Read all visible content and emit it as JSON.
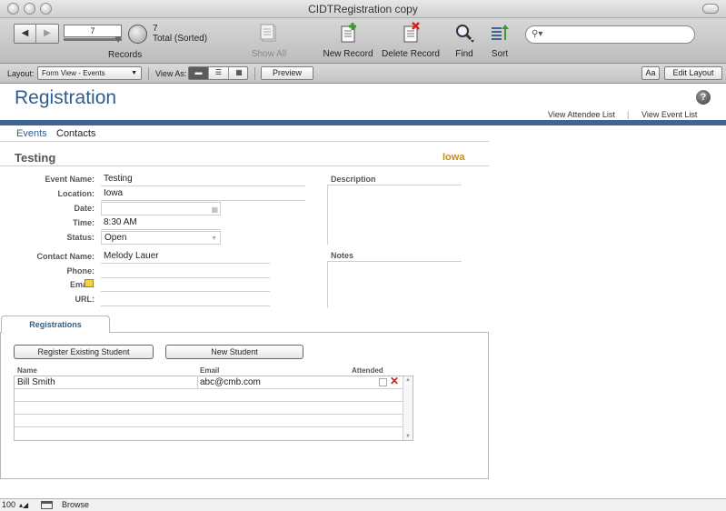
{
  "window": {
    "title": "CIDTRegistration copy"
  },
  "toolbar": {
    "record_number": "7",
    "record_total": "7",
    "record_total_label": "Total (Sorted)",
    "records_label": "Records",
    "show_all_label": "Show All",
    "new_record_label": "New Record",
    "delete_record_label": "Delete Record",
    "find_label": "Find",
    "sort_label": "Sort",
    "search_value": ""
  },
  "layout_bar": {
    "layout_label": "Layout:",
    "layout_value": "Form View - Events",
    "view_as_label": "View As:",
    "preview_label": "Preview",
    "font_button": "Aa",
    "edit_layout_label": "Edit Layout"
  },
  "header": {
    "title": "Registration",
    "help_glyph": "?",
    "view_attendee_list": "View Attendee List",
    "link_separator": "|",
    "view_event_list": "View Event List"
  },
  "tabs": {
    "events": "Events",
    "contacts": "Contacts"
  },
  "record": {
    "name": "Testing",
    "state": "Iowa",
    "fields": {
      "event_name_label": "Event Name:",
      "event_name": "Testing",
      "location_label": "Location:",
      "location": "Iowa",
      "date_label": "Date:",
      "date": "",
      "time_label": "Time:",
      "time": "8:30 AM",
      "status_label": "Status:",
      "status": "Open",
      "contact_name_label": "Contact Name:",
      "contact_name": "Melody Lauer",
      "phone_label": "Phone:",
      "phone": "",
      "email_label": "Email:",
      "email": "",
      "url_label": "URL:",
      "url": ""
    },
    "description_label": "Description",
    "notes_label": "Notes"
  },
  "registrations": {
    "tab_label": "Registrations",
    "register_existing_label": "Register Existing Student",
    "new_student_label": "New Student",
    "columns": {
      "name": "Name",
      "email": "Email",
      "attended": "Attended"
    },
    "rows": [
      {
        "name": "Bill  Smith",
        "email": "abc@cmb.com",
        "attended": false
      }
    ]
  },
  "status_bar": {
    "zoom": "100",
    "mode": "Browse"
  },
  "colors": {
    "title_blue": "#2d5d8e",
    "header_bar": "#3d6493",
    "state_gold": "#c58d1c",
    "delete_red": "#d0201a"
  },
  "icons": [
    "book-navigator-icon",
    "pie-chart-icon",
    "show-all-icon",
    "new-record-icon",
    "delete-record-icon",
    "find-icon",
    "sort-icon",
    "search-icon",
    "help-icon",
    "calendar-icon",
    "dropdown-arrow-icon",
    "email-icon",
    "delete-row-icon"
  ]
}
